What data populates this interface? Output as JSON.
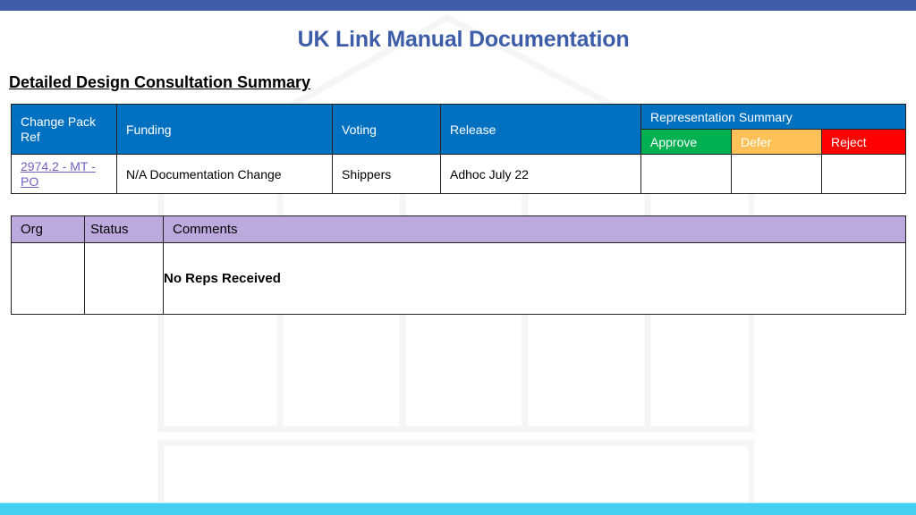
{
  "header": {
    "title": "UK Link Manual Documentation",
    "subtitle": "Detailed Design Consultation Summary"
  },
  "summary_table": {
    "columns": {
      "change_pack_ref": "Change Pack Ref",
      "funding": "Funding",
      "voting": "Voting",
      "release": "Release",
      "representation_summary": "Representation Summary",
      "approve": "Approve",
      "defer": "Defer",
      "reject": "Reject"
    },
    "row": {
      "change_pack_ref": "2974.2 - MT - PO",
      "funding": "N/A Documentation Change",
      "voting": "Shippers",
      "release": "Adhoc July 22",
      "approve": "",
      "defer": "",
      "reject": ""
    }
  },
  "reps_table": {
    "columns": {
      "org": "Org",
      "status": "Status",
      "comments": "Comments"
    },
    "row": {
      "org": "",
      "status": "",
      "comments": "No Reps Received"
    }
  },
  "colors": {
    "brand_blue": "#3e5da8",
    "header_blue": "#0070c0",
    "approve_green": "#00b050",
    "defer_amber": "#ffc157",
    "reject_red": "#ff0000",
    "reps_header_purple": "#bcaadf",
    "footer_cyan": "#42cff2"
  }
}
